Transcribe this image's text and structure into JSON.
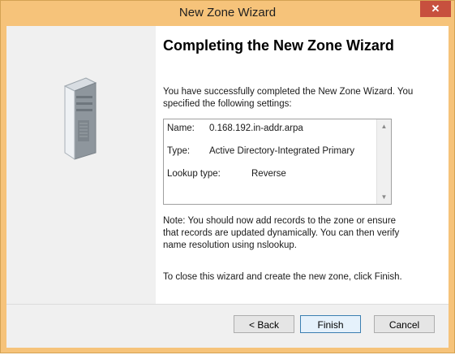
{
  "window": {
    "title": "New Zone Wizard",
    "close_glyph": "✕"
  },
  "content": {
    "heading": "Completing the New Zone Wizard",
    "intro_line1": "You have successfully completed the New Zone Wizard. You",
    "intro_line2": "specified the following settings:",
    "settings": [
      {
        "label": "Name:",
        "value": "0.168.192.in-addr.arpa"
      },
      {
        "label": "Type:",
        "value": "Active Directory-Integrated Primary"
      },
      {
        "label": "Lookup type:",
        "value": "Reverse"
      }
    ],
    "note_line1": "Note: You should now add records to the zone or ensure",
    "note_line2": "that records are updated dynamically. You can then verify",
    "note_line3": "name resolution using nslookup.",
    "close_instruction": "To close this wizard and create the new zone, click Finish."
  },
  "buttons": {
    "back": "< Back",
    "finish": "Finish",
    "cancel": "Cancel"
  },
  "colors": {
    "titlebar": "#f6c37a",
    "close": "#c7503e",
    "default_button_border": "#3c7fb1"
  },
  "icons": {
    "side_panel": "server-tower-icon",
    "scroll_up": "scroll-up-icon",
    "scroll_down": "scroll-down-icon"
  }
}
